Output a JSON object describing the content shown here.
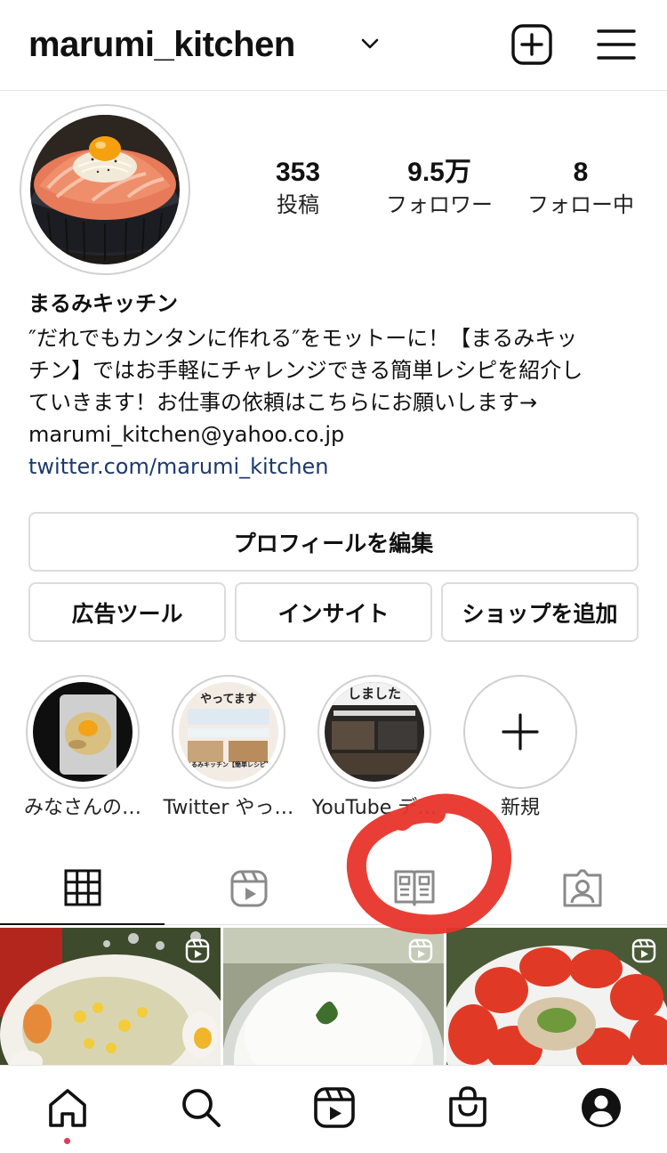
{
  "header": {
    "username": "marumi_kitchen",
    "chevron_icon": "chevron-down-icon",
    "add_icon": "plus-square-icon",
    "menu_icon": "hamburger-menu-icon"
  },
  "profile": {
    "stats": [
      {
        "value": "353",
        "label": "投稿"
      },
      {
        "value": "9.5万",
        "label": "フォロワー"
      },
      {
        "value": "8",
        "label": "フォロー中"
      }
    ],
    "name": "まるみキッチン",
    "bio_lines": [
      "″だれでもカンタンに作れる″をモットーに！【まるみキッ",
      "チン】ではお手軽にチャレンジできる簡単レシピを紹介し",
      "ていきます！お仕事の依頼はこちらにお願いします→",
      "marumi_kitchen@yahoo.co.jp"
    ],
    "link": "twitter.com/marumi_kitchen"
  },
  "buttons": {
    "edit_profile": "プロフィールを編集",
    "ad_tools": "広告ツール",
    "insights": "インサイト",
    "add_shop": "ショップを追加"
  },
  "highlights": [
    {
      "label": "みなさんの…"
    },
    {
      "label": "Twitter やっ…",
      "image_text": "やってます",
      "image_caption": "まるみキッチン【簡単レシピ】"
    },
    {
      "label": "YouTube デ…",
      "image_text": "しました"
    },
    {
      "label": "新規",
      "icon": "plus-icon"
    }
  ],
  "tabs": [
    {
      "icon": "grid-icon",
      "active": true
    },
    {
      "icon": "reels-icon",
      "active": false
    },
    {
      "icon": "guide-icon",
      "active": false
    },
    {
      "icon": "tagged-icon",
      "active": false
    }
  ],
  "bottom_nav": [
    {
      "icon": "home-icon"
    },
    {
      "icon": "search-icon"
    },
    {
      "icon": "reels-icon"
    },
    {
      "icon": "shop-icon"
    },
    {
      "icon": "profile-icon"
    }
  ],
  "colors": {
    "link": "#1b3a6b",
    "border": "#dcdcdc",
    "annotation_circle": "#e8342a",
    "notification_dot": "#e03a5b"
  }
}
